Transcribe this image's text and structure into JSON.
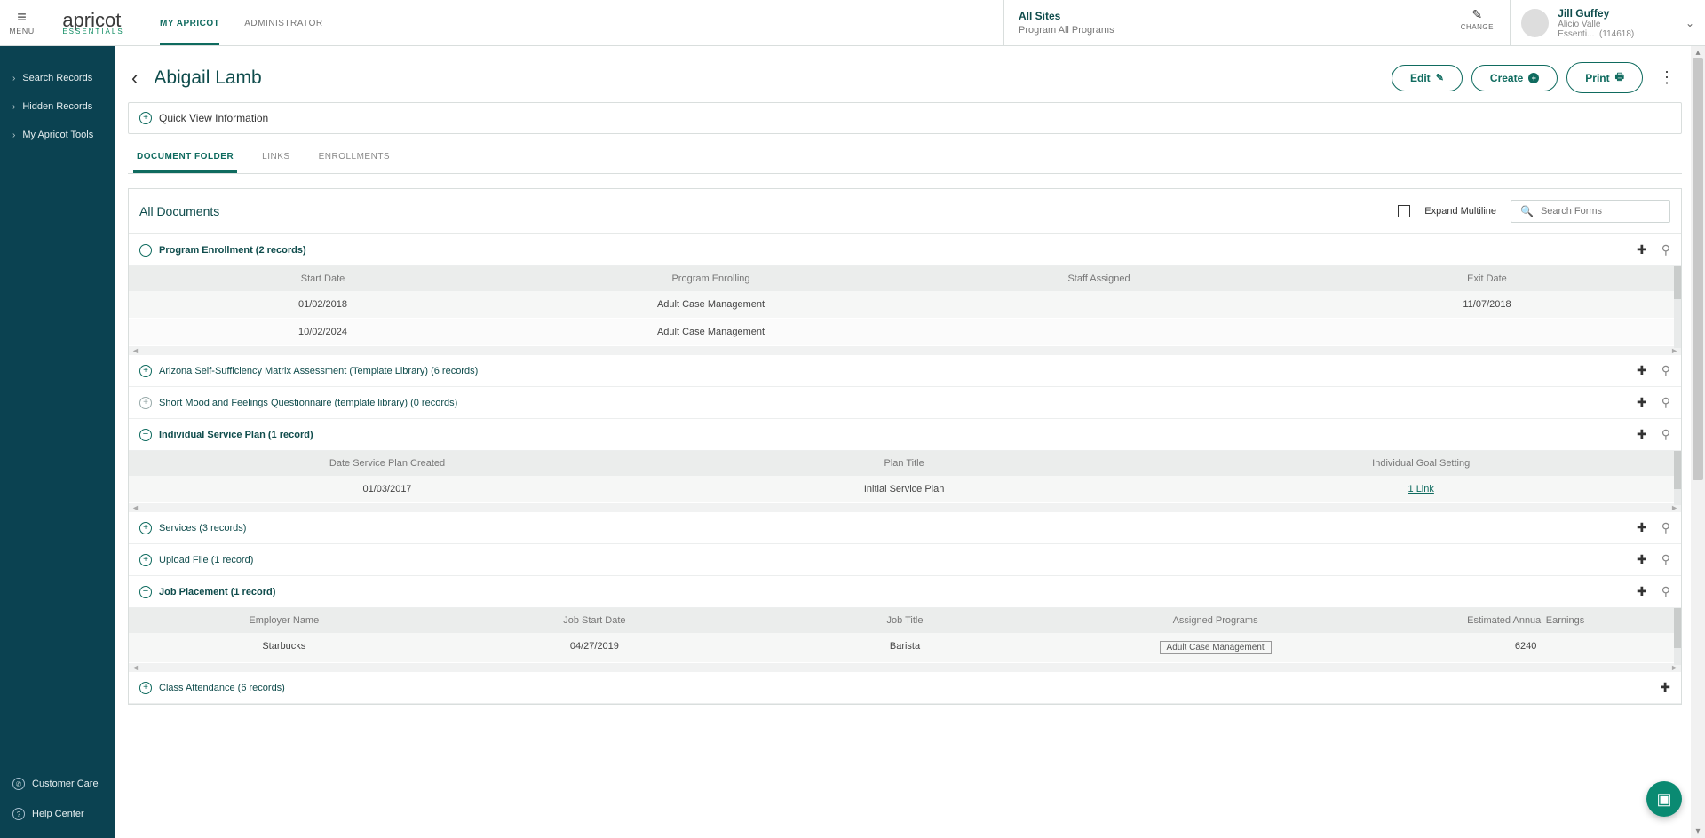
{
  "menu_label": "MENU",
  "brand": {
    "name": "apricot",
    "sub": "ESSENTIALS"
  },
  "topnav": [
    {
      "label": "MY APRICOT",
      "active": true
    },
    {
      "label": "ADMINISTRATOR",
      "active": false
    }
  ],
  "site": {
    "name": "All Sites",
    "program": "Program All Programs",
    "change": "CHANGE"
  },
  "user": {
    "name": "Jill Guffey",
    "org": "Alicio Valle Essenti...",
    "id": "(114618)"
  },
  "sidebar": {
    "items": [
      {
        "label": "Search Records"
      },
      {
        "label": "Hidden Records"
      },
      {
        "label": "My Apricot Tools"
      }
    ],
    "bottom": [
      {
        "label": "Customer Care"
      },
      {
        "label": "Help Center"
      }
    ]
  },
  "page": {
    "title": "Abigail Lamb",
    "buttons": {
      "edit": "Edit",
      "create": "Create",
      "print": "Print"
    },
    "quickview": "Quick View Information",
    "subtabs": [
      {
        "label": "DOCUMENT FOLDER",
        "active": true
      },
      {
        "label": "LINKS",
        "active": false
      },
      {
        "label": "ENROLLMENTS",
        "active": false
      }
    ],
    "docs": {
      "title": "All Documents",
      "expand": "Expand Multiline",
      "search_placeholder": "Search Forms"
    },
    "sections": {
      "program_enrollment": {
        "title": "Program Enrollment (2 records)",
        "headers": [
          "Start Date",
          "Program Enrolling",
          "Staff Assigned",
          "Exit Date"
        ],
        "rows": [
          {
            "start": "01/02/2018",
            "prog": "Adult Case Management",
            "staff": "",
            "exit": "11/07/2018"
          },
          {
            "start": "10/02/2024",
            "prog": "Adult Case Management",
            "staff": "",
            "exit": ""
          }
        ]
      },
      "arizona": {
        "title": "Arizona Self-Sufficiency Matrix Assessment (Template Library) (6 records)"
      },
      "mood": {
        "title": "Short Mood and Feelings Questionnaire (template library) (0 records)"
      },
      "isp": {
        "title": "Individual Service Plan (1 record)",
        "headers": [
          "Date Service Plan Created",
          "Plan Title",
          "Individual Goal Setting"
        ],
        "rows": [
          {
            "date": "01/03/2017",
            "plan": "Initial Service Plan",
            "goal": "1 Link"
          }
        ]
      },
      "services": {
        "title": "Services (3 records)"
      },
      "upload": {
        "title": "Upload File (1 record)"
      },
      "job": {
        "title": "Job Placement (1 record)",
        "headers": [
          "Employer Name",
          "Job Start Date",
          "Job Title",
          "Assigned Programs",
          "Estimated Annual Earnings"
        ],
        "rows": [
          {
            "emp": "Starbucks",
            "start": "04/27/2019",
            "jt": "Barista",
            "ap": "Adult Case Management",
            "earn": "6240"
          }
        ]
      },
      "class": {
        "title": "Class Attendance (6 records)"
      }
    }
  }
}
